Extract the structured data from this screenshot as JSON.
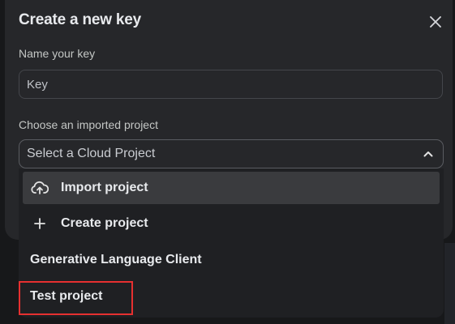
{
  "dialog": {
    "title": "Create a new key",
    "close_icon": "close-icon"
  },
  "name_field": {
    "label": "Name your key",
    "placeholder": "Key",
    "value": ""
  },
  "project_field": {
    "label": "Choose an imported project",
    "placeholder": "Select a Cloud Project",
    "chevron_icon": "chevron-up-icon",
    "expanded": true
  },
  "dropdown": {
    "items": [
      {
        "label": "Import project",
        "icon": "cloud-upload-icon",
        "highlighted": true
      },
      {
        "label": "Create project",
        "icon": "plus-icon",
        "highlighted": false
      },
      {
        "label": "Generative Language Client",
        "icon": "",
        "highlighted": false
      },
      {
        "label": "Test project",
        "icon": "",
        "highlighted": false,
        "outlined": true
      }
    ]
  },
  "colors": {
    "dialog_bg": "#26272a",
    "dropdown_bg": "#1f2023",
    "highlight_bg": "#3a3b3e",
    "text_primary": "#e8eaed",
    "annotation_red": "#e63030"
  }
}
